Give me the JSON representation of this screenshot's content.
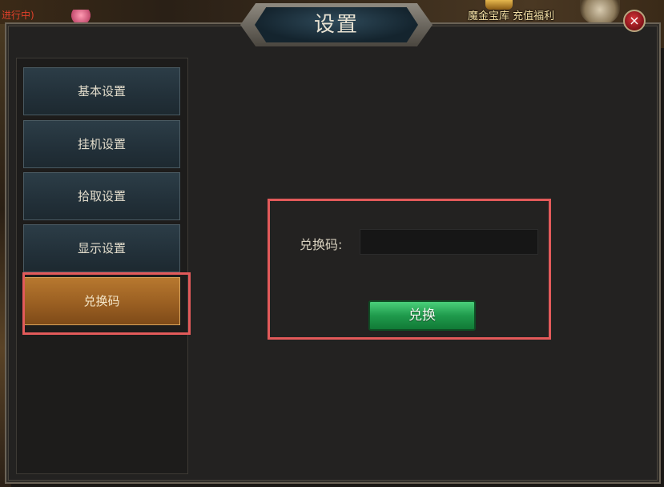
{
  "background": {
    "quest_status": "进行中)",
    "top_links": "魔金宝库 充值福利"
  },
  "window": {
    "title": "设置",
    "close_icon": "×"
  },
  "sidebar": {
    "items": [
      {
        "label": "基本设置",
        "active": false
      },
      {
        "label": "挂机设置",
        "active": false
      },
      {
        "label": "拾取设置",
        "active": false
      },
      {
        "label": "显示设置",
        "active": false
      },
      {
        "label": "兑换码",
        "active": true
      }
    ]
  },
  "redeem": {
    "label": "兑换码:",
    "input_value": "",
    "button_label": "兑换"
  },
  "colors": {
    "highlight_box": "#e25a5a",
    "active_tab": "#9a5f22",
    "redeem_button": "#1f9a4c"
  }
}
